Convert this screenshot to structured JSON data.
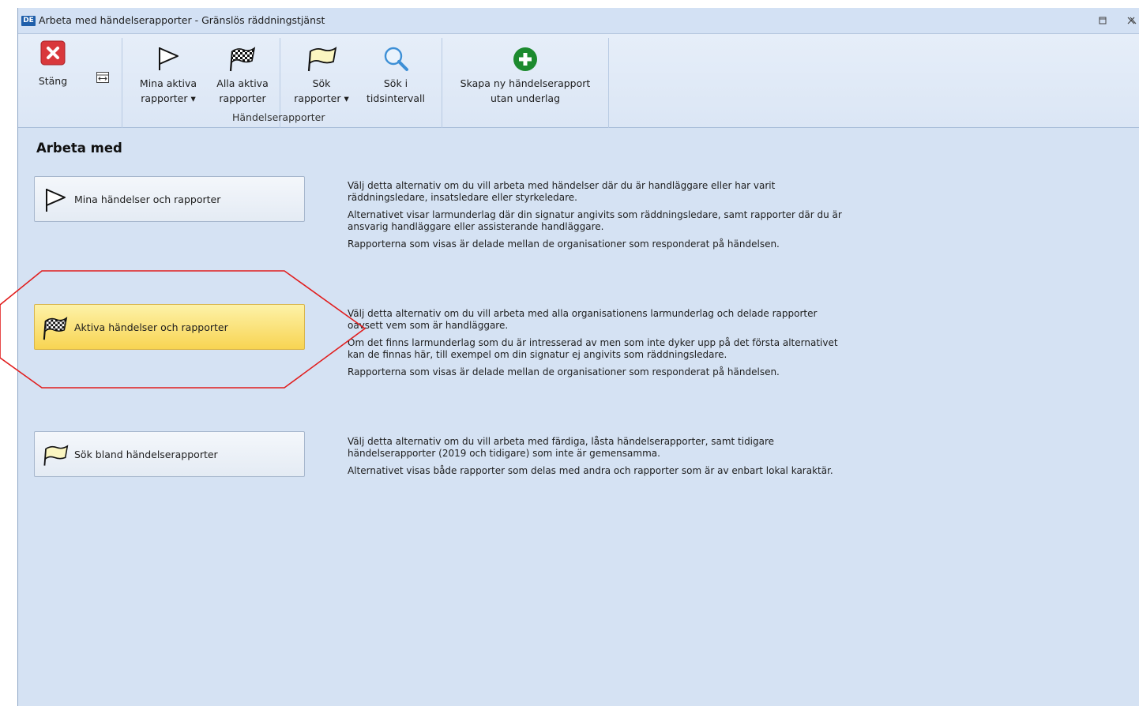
{
  "window": {
    "app_icon": "DE",
    "title": "Arbeta med händelserapporter - Gränslös räddningstjänst",
    "controls": [
      "restore-icon",
      "close-icon"
    ]
  },
  "ribbon": {
    "close_button": {
      "label": "Stäng",
      "icon": "close-icon"
    },
    "resize_icon": "resize-icon",
    "buttons": [
      {
        "line1": "Mina aktiva",
        "line2": "rapporter ▾",
        "icon": "white-flag-icon"
      },
      {
        "line1": "Alla aktiva",
        "line2": "rapporter",
        "icon": "checkered-flag-icon"
      },
      {
        "line1": "Sök",
        "line2": "rapporter ▾",
        "icon": "yellow-flag-icon"
      },
      {
        "line1": "Sök i",
        "line2": "tidsintervall",
        "icon": "search-icon"
      },
      {
        "line1": "Skapa ny händelserapport",
        "line2": "utan underlag",
        "icon": "add-circle-icon"
      }
    ],
    "group_label": "Händelserapporter"
  },
  "content": {
    "title": "Arbeta med",
    "options": [
      {
        "label": "Mina händelser och rapporter",
        "icon": "white-flag-icon",
        "description": [
          "Välj detta alternativ om du vill arbeta med händelser där du är handläggare eller har varit räddningsledare, insatsledare eller styrkeledare.",
          "Alternativet visar larmunderlag där din signatur angivits som räddningsledare, samt rapporter där du är ansvarig handläggare eller assisterande handläggare.",
          "Rapporterna som visas är delade mellan de organisationer som responderat på händelsen."
        ]
      },
      {
        "label": "Aktiva händelser och rapporter",
        "icon": "checkered-flag-icon",
        "selected": true,
        "description": [
          "Välj detta alternativ om du vill arbeta med alla organisationens larmunderlag och delade rapporter oavsett vem som är handläggare.",
          "Om det finns larmunderlag som du är intresserad av men som inte dyker upp på det första alternativet kan de finnas här, till exempel om din signatur ej angivits som räddningsledare.",
          "Rapporterna som visas är delade mellan de organisationer som responderat på händelsen."
        ]
      },
      {
        "label": "Sök bland händelserapporter",
        "icon": "yellow-flag-icon",
        "description": [
          "Välj detta alternativ om du vill arbeta med färdiga, låsta händelserapporter, samt tidigare händelserapporter (2019 och tidigare) som inte är gemensamma.",
          "Alternativet visas både rapporter som delas med andra och rapporter som är av enbart lokal karaktär."
        ]
      }
    ]
  },
  "colors": {
    "window_bg": "#d5e2f3",
    "selected_button": "#f9dd6a",
    "close_red": "#d9383c",
    "add_green": "#1c8a2e",
    "annotation_red": "#e11d1d"
  }
}
